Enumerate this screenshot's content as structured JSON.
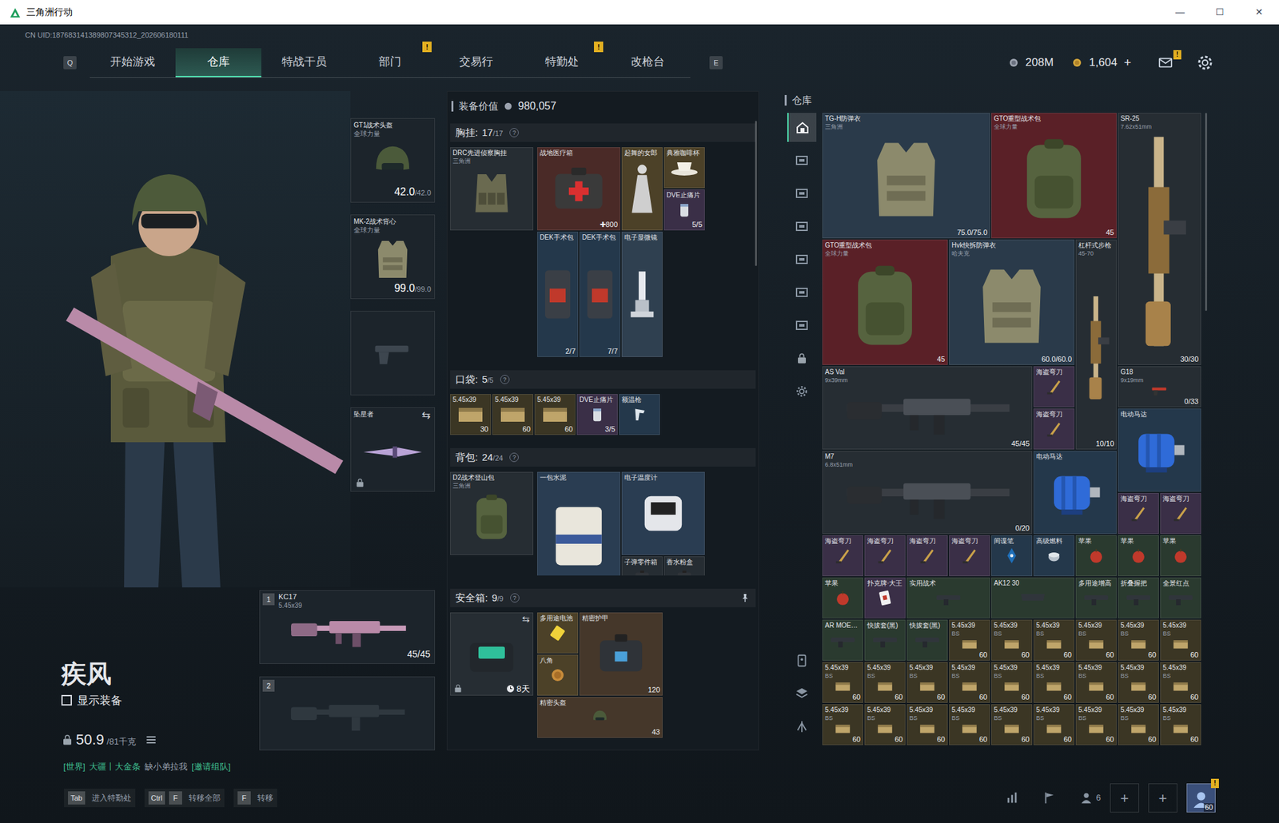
{
  "window": {
    "title": "三角洲行动",
    "controls": [
      "—",
      "☐",
      "✕"
    ]
  },
  "uid": "CN UID:187683141389807345312_202606180111",
  "nav": {
    "prev_key": "Q",
    "next_key": "E",
    "tabs": [
      {
        "label": "开始游戏",
        "selected": false
      },
      {
        "label": "仓库",
        "selected": true
      },
      {
        "label": "特战干员",
        "selected": false
      },
      {
        "label": "部门",
        "selected": false,
        "badge": "!"
      },
      {
        "label": "交易行",
        "selected": false
      },
      {
        "label": "特勤处",
        "selected": false,
        "badge": "!"
      },
      {
        "label": "改枪台",
        "selected": false
      }
    ]
  },
  "currency": {
    "coins": "208M",
    "tickets": "1,604",
    "add": "+",
    "mail_alert": "!"
  },
  "operator": {
    "name": "疾风",
    "show_equipment": {
      "label": "显示装备",
      "checked": false
    },
    "weight": "50.9",
    "capacity": "/81千克"
  },
  "equipment": [
    {
      "kind": "helmet",
      "name": "GT1战术头盔",
      "sub": "全球力量",
      "value": "42.0",
      "max": "/42.0"
    },
    {
      "kind": "armor",
      "name": "MK-2战术背心",
      "sub": "全球力量",
      "value": "99.0",
      "max": "/99.0"
    },
    {
      "kind": "pistol-empty"
    },
    {
      "kind": "melee",
      "name": "坠星者",
      "swap": "⇆",
      "locked": true
    }
  ],
  "weapons": [
    {
      "slot": "1",
      "empty": false,
      "name": "KC17",
      "caliber": "5.45x39",
      "ammo": "45/45"
    },
    {
      "slot": "2",
      "empty": true
    }
  ],
  "chat": {
    "channel": "[世界]",
    "sender": "大疆丨大金条",
    "message": "缺小弟拉我",
    "action": "[邀请组队]"
  },
  "loadout": {
    "value_label": "装备价值",
    "value": "980,057",
    "sections": [
      {
        "title": "胸挂:",
        "used": "17",
        "total": "/17",
        "help": "?",
        "container": {
          "name": "DRC先进侦察胸挂",
          "sub": "三角洲",
          "kind": "rig",
          "color": "#262d33"
        },
        "items": [
          {
            "name": "战地医疗箱",
            "count": "✚800",
            "kind": "medkit",
            "color": "#4a2a27"
          },
          {
            "name": "起舞的女郎",
            "kind": "statue",
            "color": "#4c4128"
          },
          {
            "name": "典雅咖啡杯",
            "kind": "cup",
            "color": "#4c4128"
          },
          {
            "name": "DVE止痛片",
            "count": "5/5",
            "kind": "pills",
            "color": "#3a2f47"
          },
          {
            "name": "DEK手术包",
            "count": "2/7",
            "kind": "surgery",
            "color": "#24384b"
          },
          {
            "name": "DEK手术包",
            "count": "7/7",
            "kind": "surgery",
            "color": "#24384b"
          },
          {
            "name": "电子显微镜",
            "kind": "microscope",
            "color": "#2f4050"
          }
        ]
      },
      {
        "title": "口袋:",
        "used": "5",
        "total": "/5",
        "help": "?",
        "items": [
          {
            "name": "5.45x39",
            "count": "30",
            "kind": "ammo",
            "color": "#3b3624"
          },
          {
            "name": "5.45x39",
            "count": "60",
            "kind": "ammo",
            "color": "#3b3624"
          },
          {
            "name": "5.45x39",
            "count": "60",
            "kind": "ammo",
            "color": "#3b3624"
          },
          {
            "name": "DVE止痛片",
            "count": "3/5",
            "kind": "pills",
            "color": "#3a2f47"
          },
          {
            "name": "额温枪",
            "kind": "thermogun",
            "color": "#24384b"
          }
        ]
      },
      {
        "title": "背包:",
        "used": "24",
        "total": "/24",
        "help": "?",
        "container": {
          "name": "D2战术登山包",
          "sub": "三角洲",
          "kind": "bag",
          "color": "#262d33"
        },
        "items": [
          {
            "name": "一包水泥",
            "kind": "cement",
            "color": "#2a3d52"
          },
          {
            "name": "电子温度计",
            "kind": "thermometer",
            "color": "#2a3d52"
          },
          {
            "name": "子弹零件箱",
            "kind": "case",
            "color": "#262d33"
          },
          {
            "name": "香水粉盒",
            "kind": "case",
            "color": "#262d33"
          }
        ]
      },
      {
        "title": "安全箱:",
        "used": "9",
        "total": "/9",
        "help": "?",
        "container": {
          "kind": "safebox",
          "timer": "8天",
          "locked": true,
          "swap": "⇆",
          "color": "#262d33"
        },
        "items": [
          {
            "name": "多用途电池",
            "kind": "battery",
            "color": "#4c4128"
          },
          {
            "name": "八角",
            "kind": "coin",
            "color": "#4c4128"
          },
          {
            "name": "精密护甲",
            "count": "120",
            "kind": "case",
            "color": "#45372a"
          },
          {
            "name": "精密头盔",
            "count": "43",
            "kind": "helmet",
            "color": "#45372a"
          }
        ]
      }
    ]
  },
  "warehouse": {
    "title": "仓库",
    "tabs": [
      {
        "selected": true
      },
      {
        "selected": false
      },
      {
        "selected": false
      },
      {
        "selected": false
      },
      {
        "selected": false
      },
      {
        "selected": false
      },
      {
        "selected": false
      }
    ],
    "items": [
      {
        "name": "TG-H防弹衣",
        "sub": "三角洲",
        "count": "75.0/75.0",
        "kind": "armor",
        "color": "#2a3a4a"
      },
      {
        "name": "GTO重型战术包",
        "sub": "全球力量",
        "count": "45",
        "kind": "bag",
        "color": "#5a2027"
      },
      {
        "name": "SR-25",
        "sub": "7.62x51mm",
        "count": "30/30",
        "kind": "rifle-v",
        "color": "#262d33"
      },
      {
        "name": "GTO重型战术包",
        "sub": "全球力量",
        "count": "45",
        "kind": "bag",
        "color": "#5a2027"
      },
      {
        "name": "Hvk快拆防弹衣",
        "sub": "哈夫克",
        "count": "60.0/60.0",
        "kind": "armor",
        "color": "#2a3a4a"
      },
      {
        "name": "杠杆式步枪",
        "sub": "45-70",
        "count": "10/10",
        "kind": "rifle-v",
        "color": "#262d33"
      },
      {
        "name": "AS Val",
        "sub": "9x39mm",
        "count": "45/45",
        "kind": "rifle",
        "color": "#262d33"
      },
      {
        "name": "海盗弯刀",
        "kind": "knife",
        "color": "#3a2f47"
      },
      {
        "name": "海盗弯刀",
        "kind": "knife",
        "color": "#3a2f47"
      },
      {
        "name": "G18",
        "sub": "9x19mm",
        "count": "0/33",
        "kind": "pistol",
        "color": "#262d33"
      },
      {
        "name": "电动马达",
        "kind": "motor",
        "color": "#24384b"
      },
      {
        "name": "M7",
        "sub": "6.8x51mm",
        "count": "0/20",
        "kind": "rifle",
        "color": "#262d33"
      },
      {
        "name": "电动马达",
        "kind": "motor",
        "color": "#24384b"
      },
      {
        "name": "海盗弯刀",
        "kind": "knife",
        "color": "#3a2f47"
      },
      {
        "name": "海盗弯刀",
        "kind": "knife",
        "color": "#3a2f47"
      },
      {
        "name": "海盗弯刀",
        "kind": "knife",
        "color": "#3a2f47"
      },
      {
        "name": "海盗弯刀",
        "kind": "knife",
        "color": "#3a2f47"
      },
      {
        "name": "海盗弯刀",
        "kind": "knife",
        "color": "#3a2f47"
      },
      {
        "name": "海盗弯刀",
        "kind": "knife",
        "color": "#3a2f47"
      },
      {
        "name": "间谍笔",
        "kind": "pen",
        "color": "#24384b"
      },
      {
        "name": "高级燃料",
        "kind": "can",
        "color": "#24384b"
      },
      {
        "name": "苹果",
        "kind": "apple",
        "color": "#2a3a2f"
      },
      {
        "name": "苹果",
        "kind": "apple",
        "color": "#2a3a2f"
      },
      {
        "name": "苹果",
        "kind": "apple",
        "color": "#2a3a2f"
      },
      {
        "name": "苹果",
        "kind": "apple",
        "color": "#2a3a2f"
      },
      {
        "name": "扑克牌·大王",
        "kind": "card",
        "color": "#3a2f47"
      },
      {
        "name": "实用战术",
        "kind": "attachment",
        "color": "#2a3a2f"
      },
      {
        "name": "AK12 30",
        "kind": "mag",
        "color": "#2a3a2f"
      },
      {
        "name": "多用途增高",
        "kind": "attachment",
        "color": "#2a3a2f"
      },
      {
        "name": "折叠握把",
        "kind": "attachment",
        "color": "#2a3a2f"
      },
      {
        "name": "全景红点",
        "kind": "attachment",
        "color": "#2a3a2f"
      },
      {
        "name": "AR MOE…",
        "kind": "attachment",
        "color": "#2a3a2f"
      },
      {
        "name": "快拔套(黑)",
        "kind": "attachment",
        "color": "#2a3a2f"
      },
      {
        "name": "快拔套(黑)",
        "kind": "attachment",
        "color": "#2a3a2f"
      },
      {
        "name": "5.45x39",
        "sub": "BS",
        "count": "60",
        "kind": "ammo",
        "color": "#3b3624"
      },
      {
        "name": "5.45x39",
        "sub": "BS",
        "count": "60",
        "kind": "ammo",
        "color": "#3b3624"
      },
      {
        "name": "5.45x39",
        "sub": "BS",
        "count": "60",
        "kind": "ammo",
        "color": "#3b3624"
      },
      {
        "name": "5.45x39",
        "sub": "BS",
        "count": "60",
        "kind": "ammo",
        "color": "#3b3624"
      },
      {
        "name": "5.45x39",
        "sub": "BS",
        "count": "60",
        "kind": "ammo",
        "color": "#3b3624"
      },
      {
        "name": "5.45x39",
        "sub": "BS",
        "count": "60",
        "kind": "ammo",
        "color": "#3b3624"
      },
      {
        "name": "5.45x39",
        "sub": "BS",
        "count": "60",
        "kind": "ammo",
        "color": "#3b3624"
      },
      {
        "name": "5.45x39",
        "sub": "BS",
        "count": "60",
        "kind": "ammo",
        "color": "#3b3624"
      },
      {
        "name": "5.45x39",
        "sub": "BS",
        "count": "60",
        "kind": "ammo",
        "color": "#3b3624"
      },
      {
        "name": "5.45x39",
        "sub": "BS",
        "count": "60",
        "kind": "ammo",
        "color": "#3b3624"
      },
      {
        "name": "5.45x39",
        "sub": "BS",
        "count": "60",
        "kind": "ammo",
        "color": "#3b3624"
      },
      {
        "name": "5.45x39",
        "sub": "BS",
        "count": "60",
        "kind": "ammo",
        "color": "#3b3624"
      },
      {
        "name": "5.45x39",
        "sub": "BS",
        "count": "60",
        "kind": "ammo",
        "color": "#3b3624"
      },
      {
        "name": "5.45x39",
        "sub": "BS",
        "count": "60",
        "kind": "ammo",
        "color": "#3b3624"
      },
      {
        "name": "5.45x39",
        "sub": "BS",
        "count": "60",
        "kind": "ammo",
        "color": "#3b3624"
      },
      {
        "name": "5.45x39",
        "sub": "BS",
        "count": "60",
        "kind": "ammo",
        "color": "#3b3624"
      },
      {
        "name": "5.45x39",
        "sub": "BS",
        "count": "60",
        "kind": "ammo",
        "color": "#3b3624"
      },
      {
        "name": "5.45x39",
        "sub": "BS",
        "count": "60",
        "kind": "ammo",
        "color": "#3b3624"
      },
      {
        "name": "5.45x39",
        "sub": "BS",
        "count": "60",
        "kind": "ammo",
        "color": "#3b3624"
      },
      {
        "name": "5.45x39",
        "sub": "BS",
        "count": "60",
        "kind": "ammo",
        "color": "#3b3624"
      },
      {
        "name": "5.45x39",
        "sub": "BS",
        "count": "60",
        "kind": "ammo",
        "color": "#3b3624"
      },
      {
        "name": "5.45x39",
        "sub": "BS",
        "count": "60",
        "kind": "ammo",
        "color": "#3b3624"
      },
      {
        "name": "5.45x39",
        "sub": "BS",
        "count": "60",
        "kind": "ammo",
        "color": "#3b3624"
      },
      {
        "name": "5.45x39",
        "sub": "BS",
        "count": "60",
        "kind": "ammo",
        "color": "#3b3624"
      }
    ]
  },
  "hints": [
    {
      "keys": [
        "Tab"
      ],
      "label": "进入特勤处"
    },
    {
      "keys": [
        "Ctrl",
        "F"
      ],
      "label": "转移全部"
    },
    {
      "keys": [
        "F"
      ],
      "label": "转移"
    }
  ],
  "social": {
    "friends": "6",
    "slots": [
      "+",
      "+"
    ],
    "level": "60",
    "alert": "!"
  }
}
